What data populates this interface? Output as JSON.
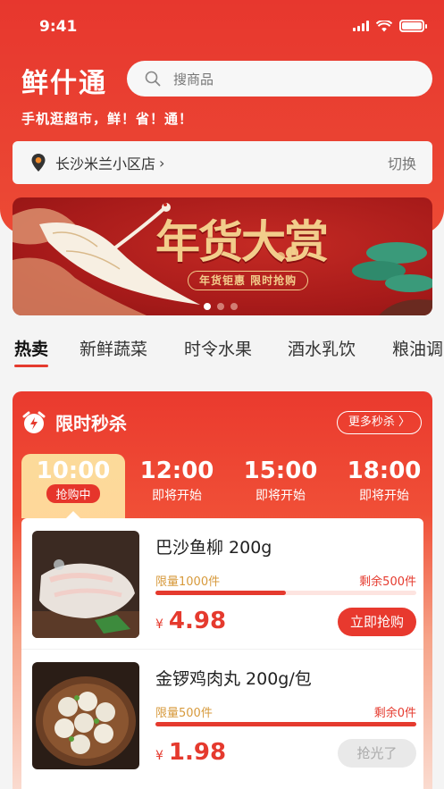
{
  "status_bar": {
    "time": "9:41"
  },
  "header": {
    "logo": "鲜什通",
    "search_placeholder": "搜商品",
    "slogan": "手机逛超市，鲜！省！通！"
  },
  "store": {
    "name": "长沙米兰小区店",
    "switch_label": "切换"
  },
  "banner": {
    "title": "年货大赏",
    "subtitle": "年货钜惠 限时抢购",
    "page_count": 3,
    "active_index": 0
  },
  "categories": [
    {
      "label": "热卖",
      "active": true
    },
    {
      "label": "新鲜蔬菜",
      "active": false
    },
    {
      "label": "时令水果",
      "active": false
    },
    {
      "label": "酒水乳饮",
      "active": false
    },
    {
      "label": "粮油调",
      "active": false
    }
  ],
  "flash_sale": {
    "title": "限时秒杀",
    "more_label": "更多秒杀 〉",
    "slots": [
      {
        "time": "10:00",
        "status": "抢购中",
        "active": true
      },
      {
        "time": "12:00",
        "status": "即将开始",
        "active": false
      },
      {
        "time": "15:00",
        "status": "即将开始",
        "active": false
      },
      {
        "time": "18:00",
        "status": "即将开始",
        "active": false
      }
    ],
    "items": [
      {
        "name": "巴沙鱼柳  200g",
        "limit": "限量1000件",
        "remaining": "剩余500件",
        "progress": 0.5,
        "currency": "¥",
        "price": "4.98",
        "button": "立即抢购",
        "sold_out": false
      },
      {
        "name": "金锣鸡肉丸 200g/包",
        "limit": "限量500件",
        "remaining": "剩余0件",
        "progress": 1.0,
        "currency": "¥",
        "price": "1.98",
        "button": "抢光了",
        "sold_out": true
      }
    ]
  },
  "colors": {
    "brand_red": "#e53a2e",
    "gold": "#f2cd8b",
    "limit_text": "#d79a3c"
  }
}
